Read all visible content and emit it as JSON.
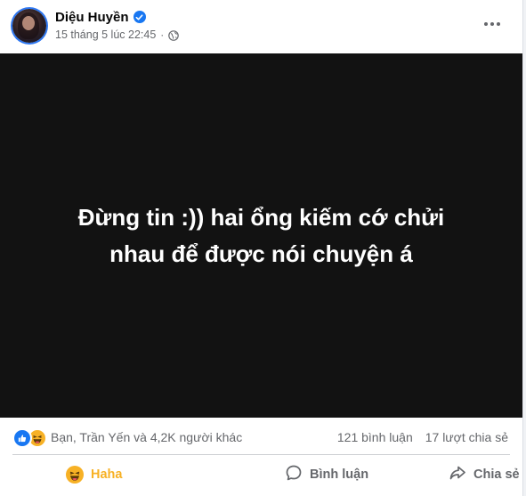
{
  "post": {
    "author": "Diệu Huyền",
    "timestamp": "15 tháng 5 lúc 22:45",
    "separator": "·",
    "image_text_line1": "Đừng tin :)) hai ổng kiếm cớ chửi",
    "image_text_line2": "nhau để được nói chuyện á"
  },
  "stats": {
    "reactors": "Bạn, Trần Yến và 4,2K người khác",
    "comments": "121 bình luận",
    "shares": "17 lượt chia sẻ"
  },
  "actions": {
    "haha": "Haha",
    "comment": "Bình luận",
    "share": "Chia sẻ"
  },
  "icons": {
    "verified": "verified-badge-icon",
    "privacy": "globe-icon",
    "more": "more-horizontal-icon",
    "like": "like-reaction-icon",
    "haha": "haha-reaction-icon",
    "comment": "comment-bubble-icon",
    "share": "share-arrow-icon"
  },
  "colors": {
    "accent": "#1877f2",
    "haha": "#f7b125",
    "image_bg": "#121212",
    "secondary_text": "#65676b"
  }
}
